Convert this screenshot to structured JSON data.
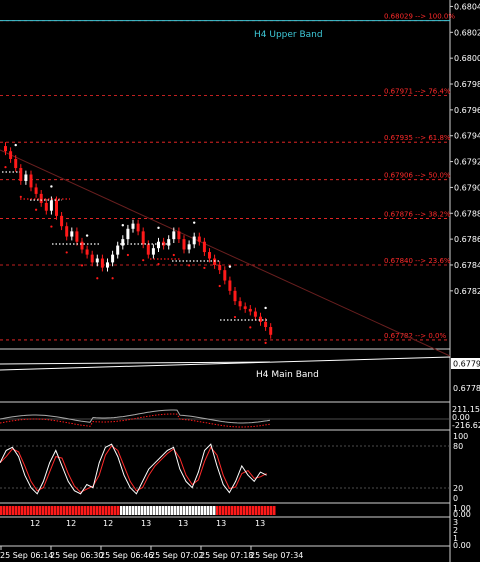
{
  "price_axis": {
    "ticks": [
      "0.68040",
      "0.68020",
      "0.68000",
      "0.67980",
      "0.67960",
      "0.67940",
      "0.67920",
      "0.67900",
      "0.67880",
      "0.67860",
      "0.67840",
      "0.67820"
    ],
    "tick_values": [
      0.6804,
      0.6802,
      0.68,
      0.6798,
      0.6796,
      0.6794,
      0.6792,
      0.679,
      0.6788,
      0.6786,
      0.6784,
      0.6782
    ],
    "current_price": "0.67798",
    "low_label": "0.67780"
  },
  "fib_levels": [
    {
      "price": 0.68029,
      "label": "0.68029 --> 100.0%"
    },
    {
      "price": 0.67971,
      "label": "0.67971 --> 76.4%"
    },
    {
      "price": 0.67935,
      "label": "0.67935 --> 61.8%"
    },
    {
      "price": 0.67906,
      "label": "0.67906 --> 50.0%"
    },
    {
      "price": 0.67876,
      "label": "0.67876 --> 38.2%"
    },
    {
      "price": 0.6784,
      "label": "0.67840 --> 23.6%"
    },
    {
      "price": 0.67782,
      "label": "0.67782 --> 0.0%"
    }
  ],
  "bands": {
    "upper_label": "H4 Upper Band",
    "upper_price": 0.68029,
    "main_label": "H4 Main Band",
    "upper_color": "#3ec8d8",
    "main_color": "#ffffff"
  },
  "osc1": {
    "labels": [
      "211.158",
      "0.00",
      "-216.624"
    ]
  },
  "osc2": {
    "labels": [
      "100",
      "80",
      "20",
      "0"
    ]
  },
  "strip": {
    "labels": [
      "1.00",
      "0.00"
    ],
    "count_labels": [
      "12",
      "12",
      "12",
      "13",
      "13",
      "13",
      "13",
      "13"
    ]
  },
  "bottom_axis": {
    "labels": [
      "3",
      "2",
      "1",
      "0.00"
    ]
  },
  "time_axis": {
    "labels": [
      "25 Sep 06:14",
      "25 Sep 06:30",
      "25 Sep 06:46",
      "25 Sep 07:02",
      "25 Sep 07:18",
      "25 Sep 07:34"
    ]
  },
  "colors": {
    "bull": "#ffffff",
    "bear": "#ff1a1a",
    "fib": "#ff2a2a",
    "grid": "#9a9a9a",
    "stoch_main": "#ffffff",
    "stoch_signal": "#ff2a2a"
  },
  "chart_data": {
    "type": "candlestick",
    "ylim": [
      0.67775,
      0.68045
    ],
    "closes": [
      0.67928,
      0.67922,
      0.67915,
      0.67905,
      0.6791,
      0.679,
      0.67895,
      0.67888,
      0.67882,
      0.6789,
      0.67878,
      0.6787,
      0.67862,
      0.67866,
      0.67858,
      0.67852,
      0.67848,
      0.67842,
      0.67845,
      0.67838,
      0.67842,
      0.67848,
      0.67855,
      0.6786,
      0.67868,
      0.67872,
      0.67866,
      0.67856,
      0.67848,
      0.67853,
      0.67858,
      0.67855,
      0.6786,
      0.67866,
      0.6786,
      0.67852,
      0.67856,
      0.67862,
      0.67858,
      0.6785,
      0.67845,
      0.6784,
      0.67836,
      0.67828,
      0.6782,
      0.67812,
      0.67808,
      0.67806,
      0.67804,
      0.678,
      0.67796,
      0.67792,
      0.67786
    ]
  }
}
